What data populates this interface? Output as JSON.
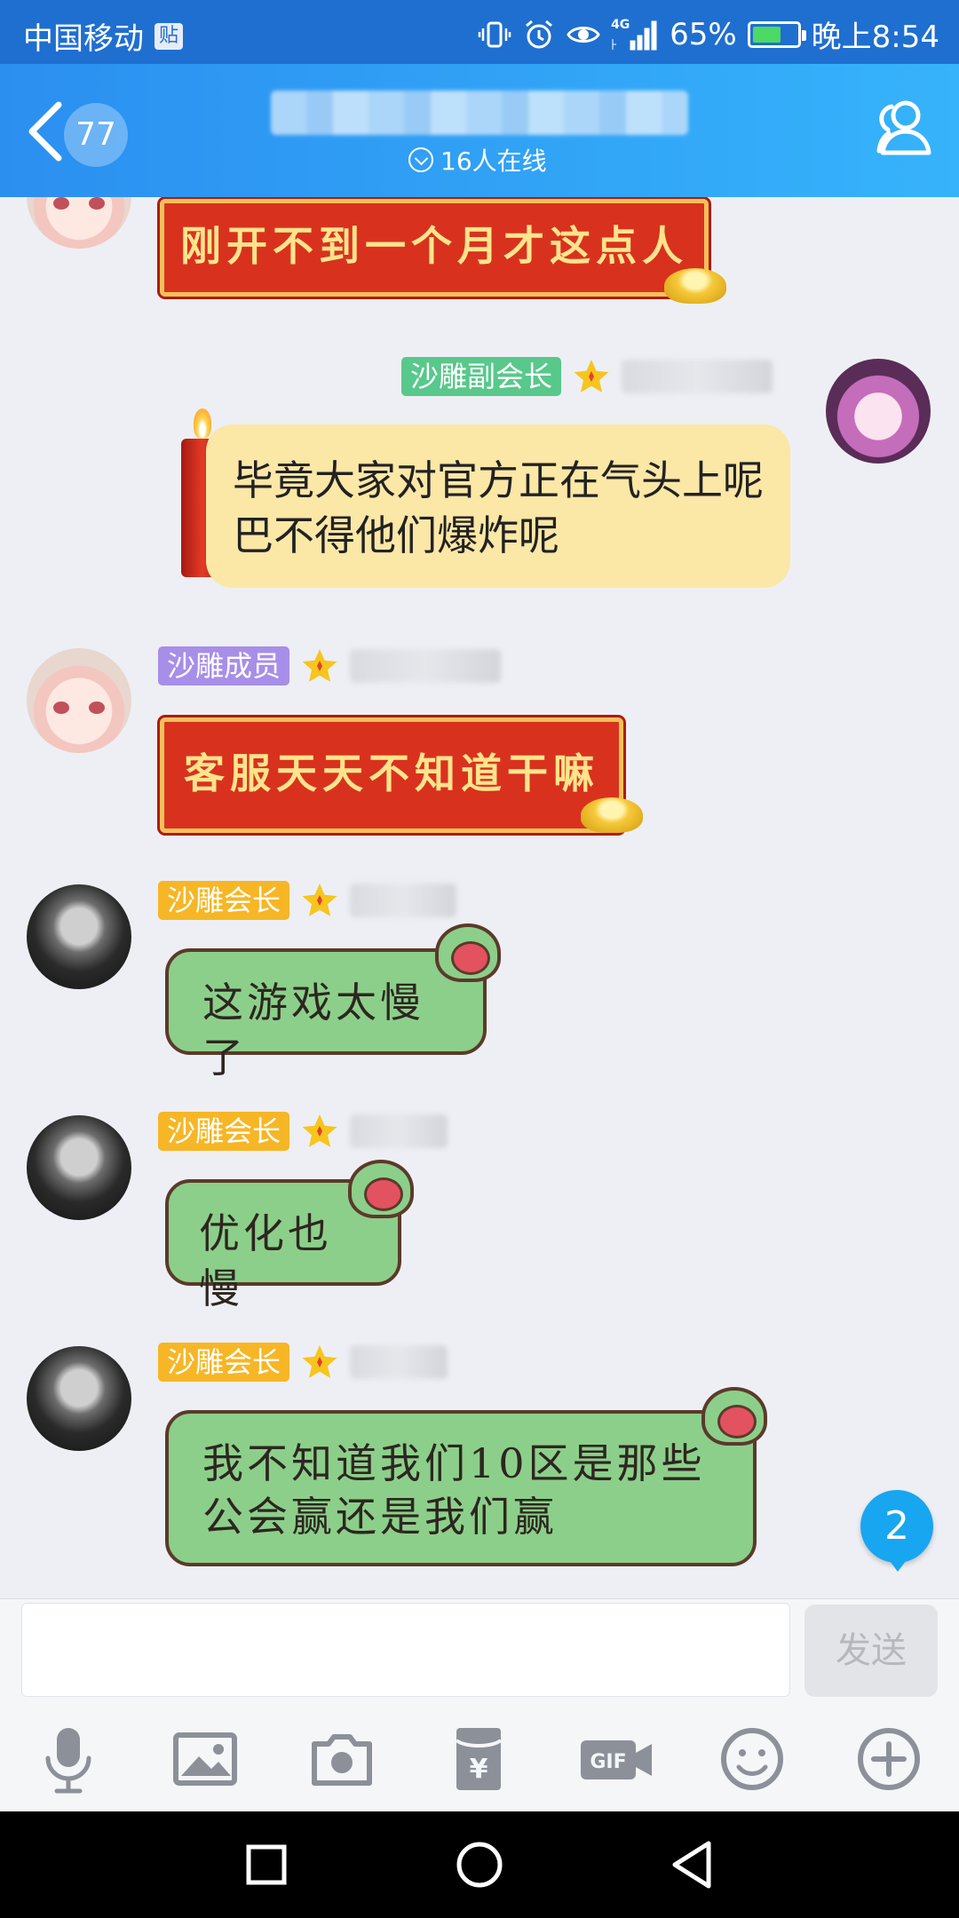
{
  "status_bar": {
    "carrier": "中国移动",
    "carrier_badge": "贴",
    "network": "4G",
    "battery_percent_label": "65%",
    "battery_level": 0.65,
    "time": "晚上8:54",
    "icons": [
      "vibrate-icon",
      "alarm-icon",
      "eye-icon",
      "signal-icon",
      "battery-icon"
    ]
  },
  "title_bar": {
    "unread_count": "77",
    "online_text": "16人在线",
    "icons": [
      "back-icon",
      "members-icon"
    ]
  },
  "messages": [
    {
      "side": "left",
      "style": "red-banner",
      "text": "刚开不到一个月才这点人"
    },
    {
      "side": "right",
      "role": "沙雕副会长",
      "role_color": "#58c88b",
      "style": "cream-candle",
      "text": "毕竟大家对官方正在气头上呢 巴不得他们爆炸呢"
    },
    {
      "side": "left",
      "role": "沙雕成员",
      "role_color": "#a78ee8",
      "style": "red-banner",
      "text": "客服天天不知道干嘛"
    },
    {
      "side": "left",
      "role": "沙雕会长",
      "role_color": "#f6b626",
      "style": "green-monster",
      "text": "这游戏太慢了"
    },
    {
      "side": "left",
      "role": "沙雕会长",
      "role_color": "#f6b626",
      "style": "green-monster",
      "text": "优化也慢"
    },
    {
      "side": "left",
      "role": "沙雕会长",
      "role_color": "#f6b626",
      "style": "green-monster",
      "text": "我不知道我们10区是那些公会赢还是我们赢"
    }
  ],
  "new_message_badge": "2",
  "input_bar": {
    "placeholder": "",
    "send_label": "发送",
    "tools": [
      "microphone-icon",
      "image-icon",
      "camera-icon",
      "red-packet-icon",
      "gif-icon",
      "emoji-icon",
      "plus-icon"
    ]
  },
  "nav_bar": {
    "buttons": [
      "recents-icon",
      "home-icon",
      "back-nav-icon"
    ]
  }
}
